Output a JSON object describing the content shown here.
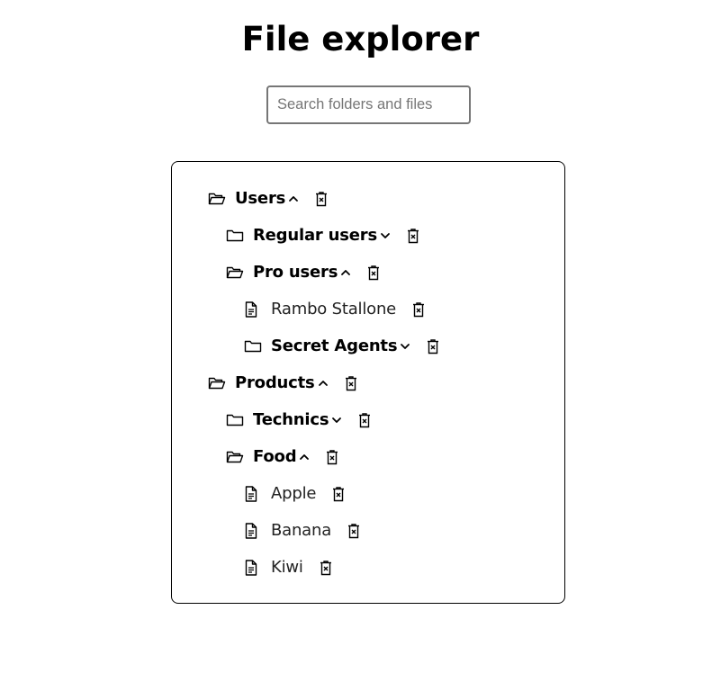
{
  "page": {
    "title": "File explorer"
  },
  "search": {
    "placeholder": "Search folders and files",
    "value": ""
  },
  "tree": [
    {
      "type": "folder",
      "name": "Users",
      "expanded": true,
      "depth": 0
    },
    {
      "type": "folder",
      "name": "Regular users",
      "expanded": false,
      "depth": 1
    },
    {
      "type": "folder",
      "name": "Pro users",
      "expanded": true,
      "depth": 1
    },
    {
      "type": "file",
      "name": "Rambo Stallone",
      "depth": 2
    },
    {
      "type": "folder",
      "name": "Secret Agents",
      "expanded": false,
      "depth": 2
    },
    {
      "type": "folder",
      "name": "Products",
      "expanded": true,
      "depth": 0
    },
    {
      "type": "folder",
      "name": "Technics",
      "expanded": false,
      "depth": 1
    },
    {
      "type": "folder",
      "name": "Food",
      "expanded": true,
      "depth": 1
    },
    {
      "type": "file",
      "name": "Apple",
      "depth": 2
    },
    {
      "type": "file",
      "name": "Banana",
      "depth": 2
    },
    {
      "type": "file",
      "name": "Kiwi",
      "depth": 2
    }
  ],
  "icons": {
    "folder_open": "folder-open-icon",
    "folder_closed": "folder-icon",
    "file": "file-text-icon",
    "delete": "trash-icon",
    "collapse": "chevron-up-icon",
    "expand": "chevron-down-icon"
  }
}
